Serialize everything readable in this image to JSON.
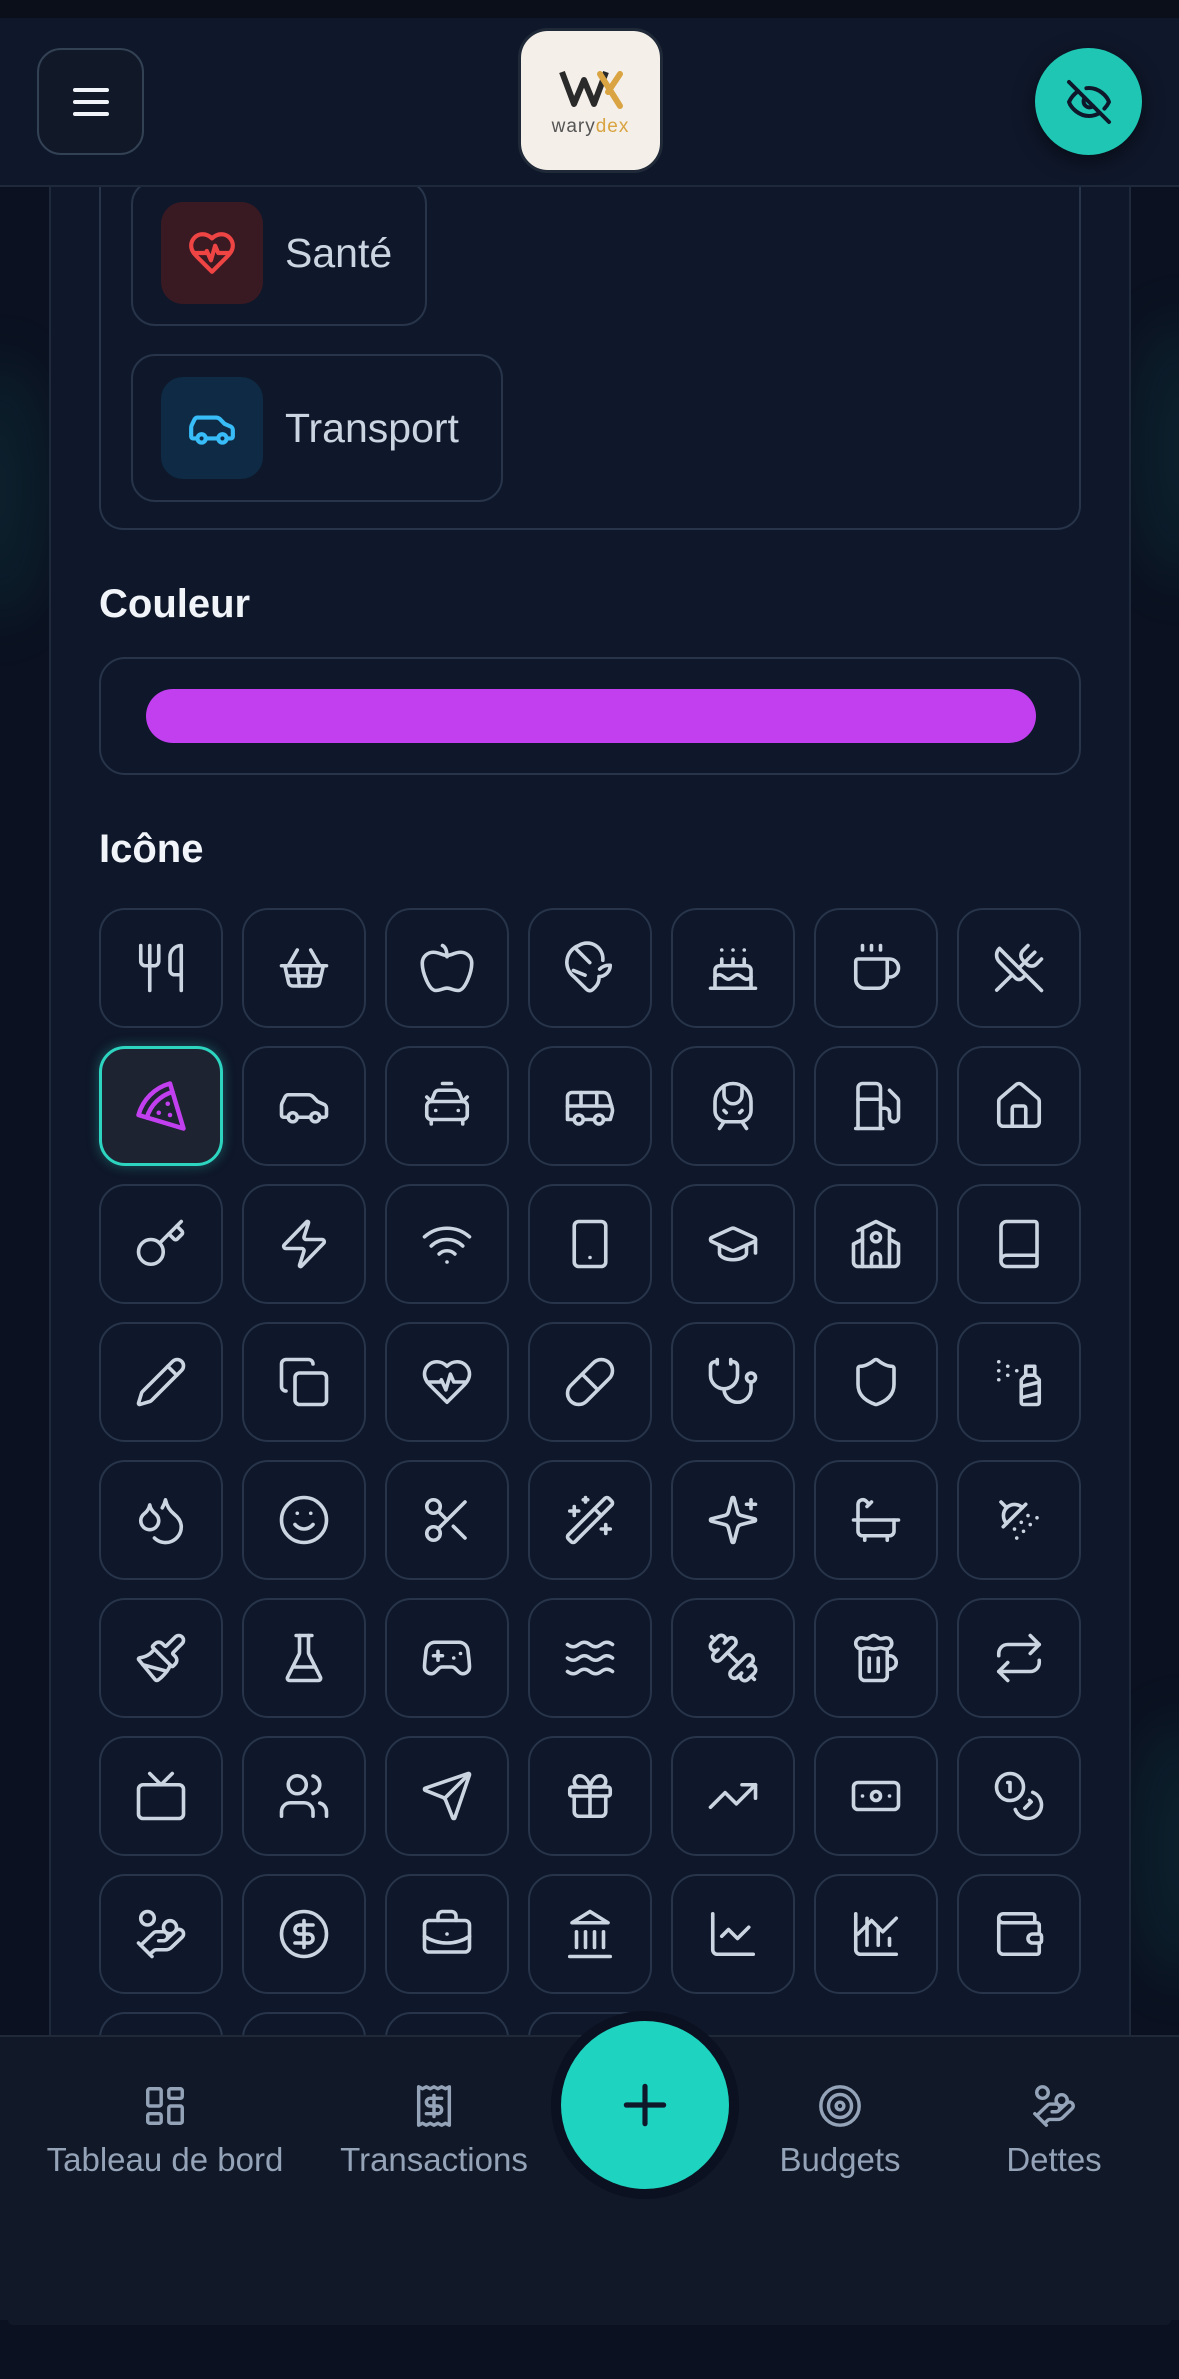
{
  "header": {
    "logo_word_a": "wary",
    "logo_word_b": "dex",
    "brand_color": "#1ec6b3"
  },
  "categories": [
    {
      "label": "Santé",
      "icon": "heart-pulse-icon",
      "color": "#ef4444"
    },
    {
      "label": "Transport",
      "icon": "car-icon",
      "color": "#38bdf8"
    }
  ],
  "color_section": {
    "label": "Couleur",
    "selected_color": "#c23ff0"
  },
  "icon_section": {
    "label": "Icône",
    "selected": "pizza-icon",
    "icons": [
      "utensils-icon",
      "shopping-basket-icon",
      "apple-icon",
      "croissant-icon",
      "cake-icon",
      "coffee-icon",
      "utensils-crossed-icon",
      "pizza-icon",
      "car-icon",
      "taxi-icon",
      "bus-icon",
      "train-icon",
      "fuel-icon",
      "home-icon",
      "key-icon",
      "zap-icon",
      "wifi-icon",
      "tablet-icon",
      "graduation-cap-icon",
      "school-icon",
      "book-icon",
      "pencil-icon",
      "copy-icon",
      "heart-pulse-icon",
      "pill-icon",
      "stethoscope-icon",
      "shield-icon",
      "spray-icon",
      "droplets-icon",
      "smile-icon",
      "scissors-icon",
      "magic-wand-icon",
      "sparkles-icon",
      "bath-icon",
      "shower-icon",
      "paintbrush-icon",
      "flask-icon",
      "gamepad-icon",
      "waves-icon",
      "dumbbell-icon",
      "beer-icon",
      "repeat-icon",
      "tv-icon",
      "users-icon",
      "send-icon",
      "gift-icon",
      "trending-up-icon",
      "banknote-icon",
      "coins-icon",
      "hand-coins-icon",
      "dollar-circle-icon",
      "briefcase-icon",
      "bank-icon",
      "line-chart-icon",
      "bar-signal-icon",
      "wallet-icon"
    ]
  },
  "bottom_nav": {
    "dashboard": "Tableau de bord",
    "transactions": "Transactions",
    "budgets": "Budgets",
    "debts": "Dettes"
  }
}
